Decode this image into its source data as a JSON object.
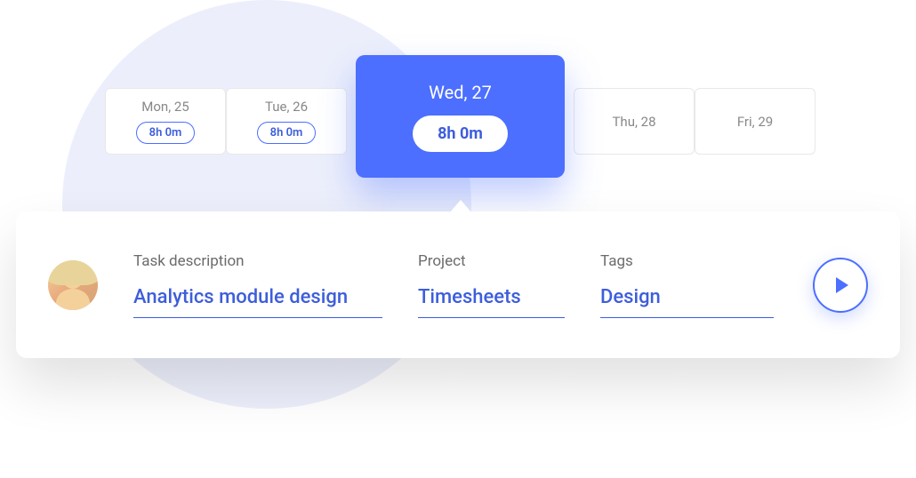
{
  "dates": {
    "mon": {
      "label": "Mon, 25",
      "time": "8h 0m"
    },
    "tue": {
      "label": "Tue, 26",
      "time": "8h 0m"
    },
    "wed": {
      "label": "Wed, 27",
      "time": "8h 0m"
    },
    "thu": {
      "label": "Thu, 28"
    },
    "fri": {
      "label": "Fri, 29"
    }
  },
  "task": {
    "description_label": "Task description",
    "description_value": "Analytics module design",
    "project_label": "Project",
    "project_value": "Timesheets",
    "tags_label": "Tags",
    "tags_value": "Design"
  }
}
